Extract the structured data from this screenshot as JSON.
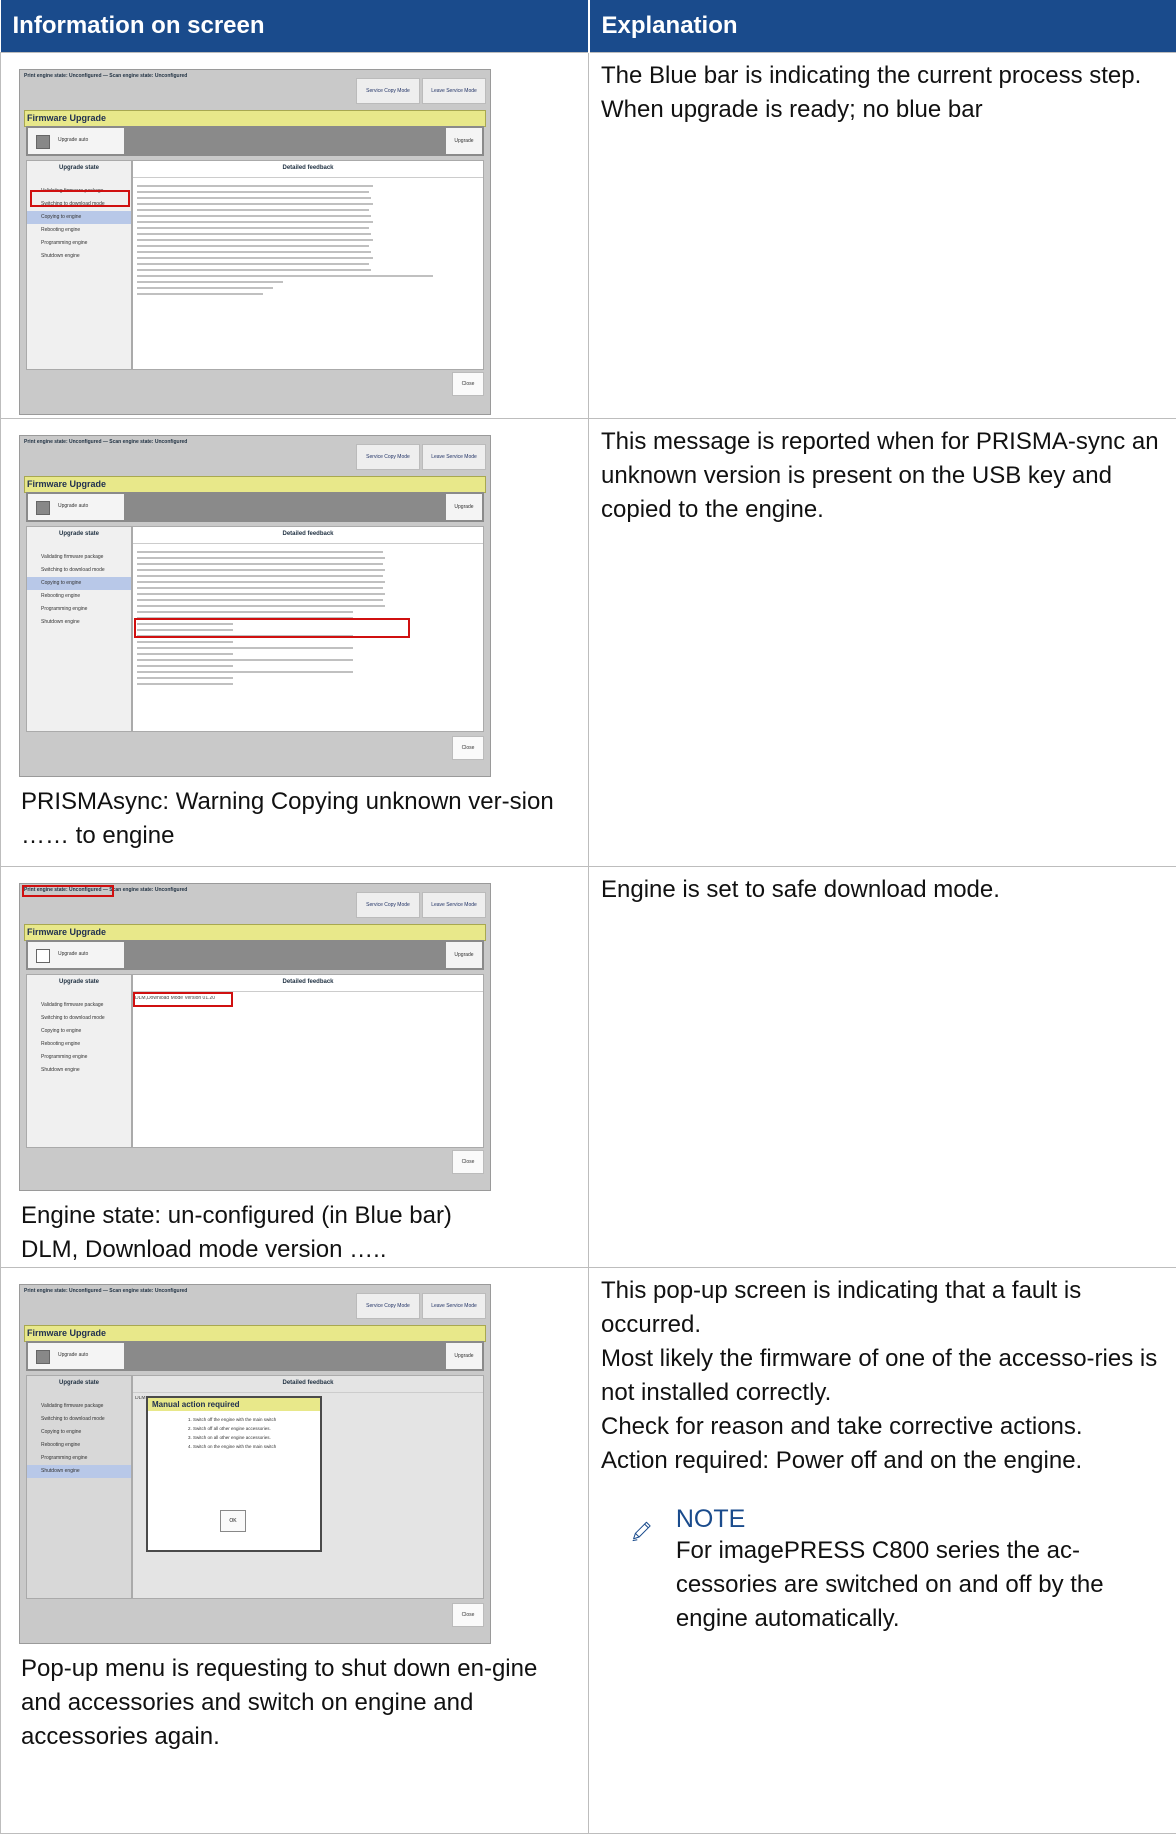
{
  "header": {
    "col1": "Information on screen",
    "col2": "Explanation"
  },
  "rows": [
    {
      "explanation": [
        "The Blue bar is indicating the current process step.",
        "When upgrade is ready; no blue bar"
      ],
      "screenshot": {
        "status": "Print engine state: Unconfigured — Scan engine state: Unconfigured",
        "service_copy": "Service Copy Mode",
        "leave_service": "Leave Service Mode",
        "title": "Firmware Upgrade",
        "upgrade_auto": "Upgrade auto",
        "upgrade": "Upgrade",
        "upgrade_state": "Upgrade state",
        "detailed_feedback": "Detailed feedback",
        "steps": [
          "Validating firmware package",
          "Switching to download mode",
          "Copying to engine",
          "Rebooting engine",
          "Programming engine",
          "Shutdown engine"
        ],
        "close": "Close"
      }
    },
    {
      "explanation": [
        "This message is reported when for PRISMA-sync an unknown version is present on the USB key and copied to the engine."
      ],
      "caption": "PRISMAsync: Warning Copying unknown ver-sion …… to engine"
    },
    {
      "explanation": [
        "Engine is set to safe download mode."
      ],
      "caption_lines": [
        "Engine state: un-configured (in Blue bar)",
        "DLM, Download mode version ….."
      ],
      "dlm_line": "DLM,Download Mode Version 01.20"
    },
    {
      "explanation": [
        "This pop-up screen is indicating that a fault is occurred.",
        "Most likely the firmware of one of the accesso-ries is not installed correctly.",
        "Check for reason and take corrective actions.",
        "Action required: Power off and on the engine."
      ],
      "note": {
        "title": "NOTE",
        "text": "For imagePRESS C800 series the ac-cessories are switched on and off by the engine automatically."
      },
      "caption": "Pop-up menu is requesting to shut down en-gine and accessories and switch on engine and accessories again.",
      "popup": {
        "reboot_line": "DLM +++ REBOOT in 10 seconds +++",
        "title": "Manual action required",
        "steps": [
          "1. Switch off the engine with the main switch",
          "2. Switch off all other engine accessories.",
          "3. Switch on all other engine accessories.",
          "4. Switch on the engine with the main switch"
        ],
        "ok": "OK"
      }
    }
  ]
}
